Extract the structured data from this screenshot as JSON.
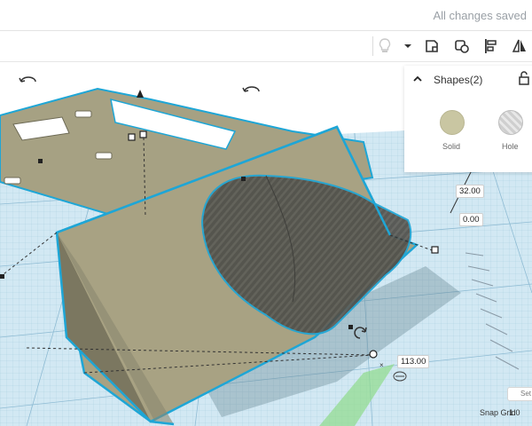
{
  "header": {
    "save_status": "All changes saved"
  },
  "toolbar": {
    "icons": [
      "light-bulb-icon",
      "dropdown-arrow-icon",
      "note-icon",
      "group-icon",
      "align-icon",
      "mirror-icon"
    ]
  },
  "inspector": {
    "title": "Shapes(2)",
    "solid_label": "Solid",
    "hole_label": "Hole",
    "colors": {
      "solid": "#c9c6a2",
      "hole": "#d9d9d9"
    }
  },
  "dimensions": {
    "height": "32.00",
    "elevation": "0.00",
    "length": "113.00"
  },
  "footer": {
    "snap_grid_label": "Snap Grid",
    "snap_grid_value": "1.0",
    "settings_label": "Set"
  },
  "colors": {
    "grid_bg": "#cfe6f2",
    "selection_outline": "#1ea6d6",
    "shape_fill": "#a8a283"
  }
}
